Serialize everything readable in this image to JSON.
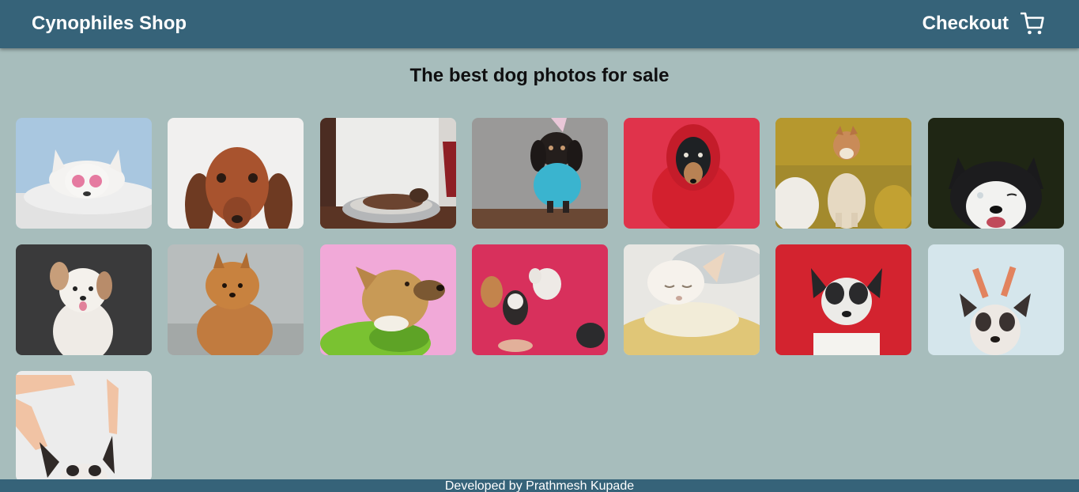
{
  "header": {
    "brand": "Cynophiles Shop",
    "checkout_label": "Checkout",
    "checkout_icon": "cart-icon",
    "background": "#366379"
  },
  "main": {
    "title": "The best dog photos for sale",
    "background": "#a7bdbc",
    "photos": [
      {
        "icon": "white-dog-heart-sunglasses-photo"
      },
      {
        "icon": "dachshund-face-photo"
      },
      {
        "icon": "dog-in-bed-photo"
      },
      {
        "icon": "dachshund-party-hat-photo"
      },
      {
        "icon": "dachshund-red-hoodie-photo"
      },
      {
        "icon": "shiba-inu-yellow-chair-photo"
      },
      {
        "icon": "husky-winking-photo"
      },
      {
        "icon": "fluffy-white-puppy-photo"
      },
      {
        "icon": "pomeranian-photo"
      },
      {
        "icon": "dog-green-boa-photo"
      },
      {
        "icon": "dogs-pink-floor-photo"
      },
      {
        "icon": "sleeping-chihuahua-photo"
      },
      {
        "icon": "french-bulldog-free-sign-photo"
      },
      {
        "icon": "french-bulldog-antlers-photo"
      },
      {
        "icon": "french-bulldog-ears-held-photo"
      }
    ]
  },
  "footer": {
    "text": "Developed by Prathmesh Kupade"
  }
}
